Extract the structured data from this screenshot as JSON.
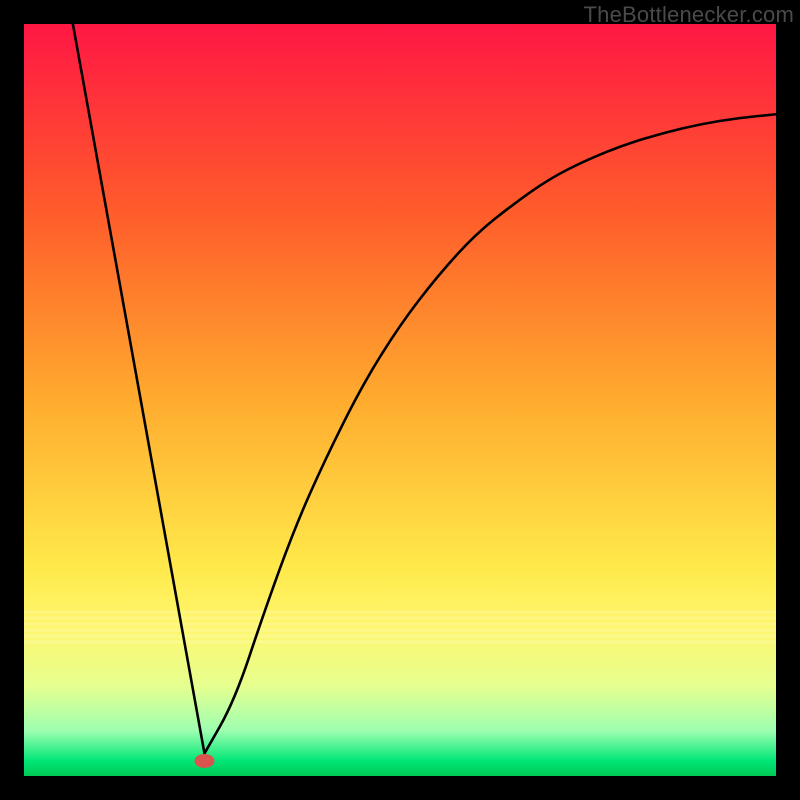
{
  "watermark": "TheBottlenecker.com",
  "chart_data": {
    "type": "line",
    "title": "",
    "xlabel": "",
    "ylabel": "",
    "xlim": [
      0,
      100
    ],
    "ylim": [
      0,
      100
    ],
    "gradient_stops": [
      {
        "offset": 0,
        "color": "#ff1744"
      },
      {
        "offset": 25,
        "color": "#ff5c2b"
      },
      {
        "offset": 50,
        "color": "#ffab2e"
      },
      {
        "offset": 72,
        "color": "#ffe94a"
      },
      {
        "offset": 80,
        "color": "#fff66d"
      },
      {
        "offset": 88,
        "color": "#e6ff8f"
      },
      {
        "offset": 94,
        "color": "#9dffb0"
      },
      {
        "offset": 98,
        "color": "#00e676"
      },
      {
        "offset": 100,
        "color": "#00c853"
      }
    ],
    "curve": {
      "min_x": 24,
      "left": [
        {
          "x": 6.5,
          "y": 100
        },
        {
          "x": 24,
          "y": 3
        }
      ],
      "right": [
        {
          "x": 24,
          "y": 3
        },
        {
          "x": 28,
          "y": 10
        },
        {
          "x": 32,
          "y": 22
        },
        {
          "x": 36,
          "y": 33
        },
        {
          "x": 40,
          "y": 42
        },
        {
          "x": 45,
          "y": 52
        },
        {
          "x": 50,
          "y": 60
        },
        {
          "x": 55,
          "y": 66.5
        },
        {
          "x": 60,
          "y": 72
        },
        {
          "x": 65,
          "y": 76
        },
        {
          "x": 70,
          "y": 79.5
        },
        {
          "x": 75,
          "y": 82
        },
        {
          "x": 80,
          "y": 84
        },
        {
          "x": 85,
          "y": 85.5
        },
        {
          "x": 90,
          "y": 86.7
        },
        {
          "x": 95,
          "y": 87.5
        },
        {
          "x": 100,
          "y": 88
        }
      ]
    },
    "marker": {
      "x": 24,
      "y": 2,
      "color": "#d9534f"
    }
  }
}
